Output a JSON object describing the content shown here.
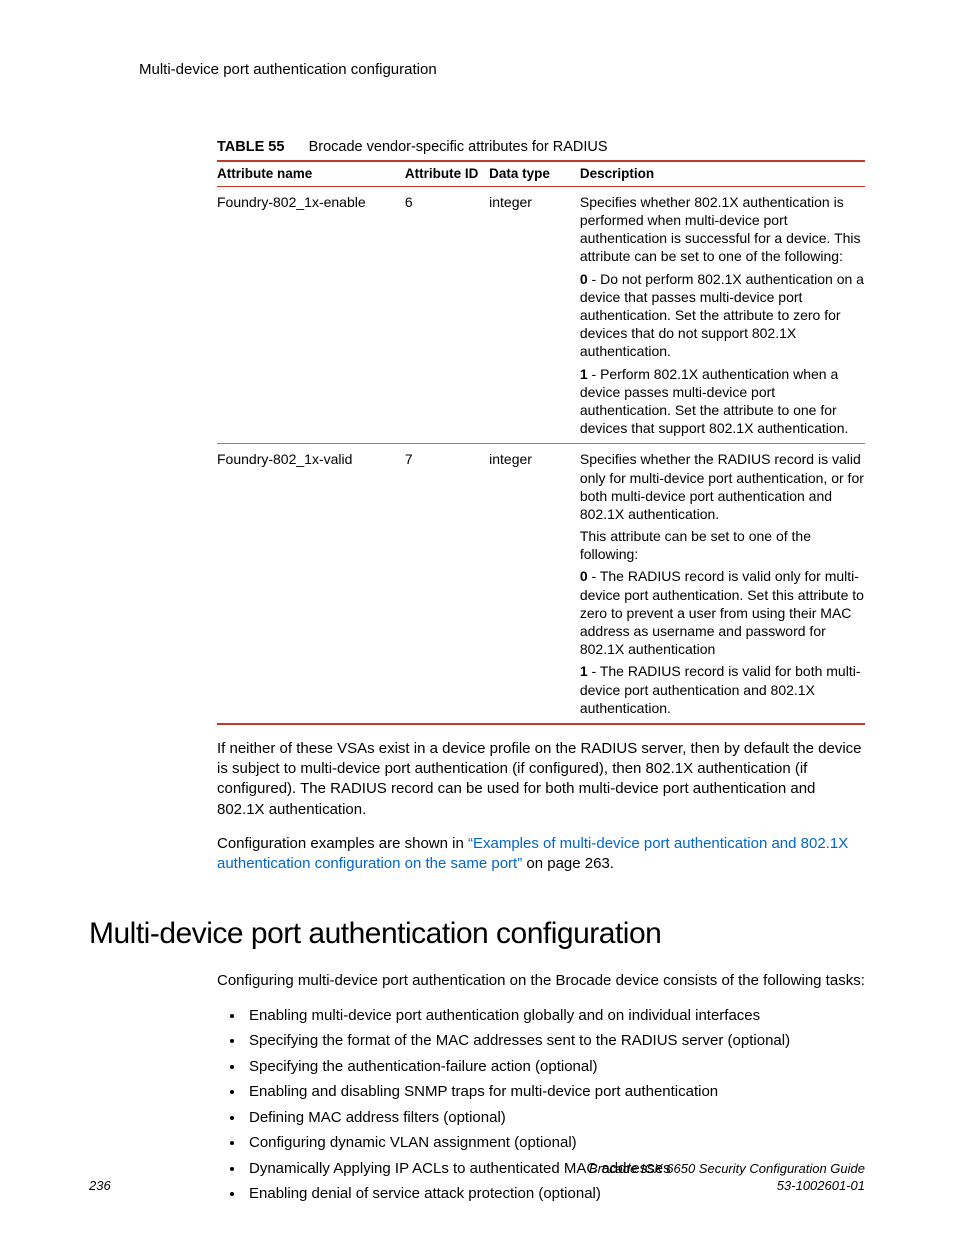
{
  "running_head": "Multi-device port authentication configuration",
  "table": {
    "label": "TABLE 55",
    "caption": "Brocade vendor-specific attributes for RADIUS",
    "headers": {
      "name": "Attribute name",
      "id": "Attribute ID",
      "type": "Data type",
      "desc": "Description"
    },
    "rows": [
      {
        "name": "Foundry-802_1x-enable",
        "id": "6",
        "type": "integer",
        "desc": {
          "intro": "Specifies whether 802.1X authentication is performed when multi-device port authentication is successful for a device. This attribute can be set to one of the following:",
          "opt0_lead": "0",
          "opt0_text": " - Do not perform 802.1X authentication on a device that passes multi-device port authentication. Set the attribute to zero for devices that do not support 802.1X authentication.",
          "opt1_lead": "1",
          "opt1_text": " - Perform 802.1X authentication when a device passes multi-device port authentication. Set the attribute to one for devices that support 802.1X authentication."
        }
      },
      {
        "name": "Foundry-802_1x-valid",
        "id": "7",
        "type": "integer",
        "desc": {
          "intro": "Specifies whether the RADIUS record is valid only for multi-device port authentication, or for both multi-device port authentication and 802.1X authentication.",
          "note": "This attribute can be set to one of the following:",
          "opt0_lead": "0",
          "opt0_text": " - The RADIUS record is valid only for multi-device port authentication. Set this attribute to zero to prevent a user from using their MAC address as username and password for 802.1X authentication",
          "opt1_lead": "1",
          "opt1_text": " - The RADIUS record is valid for both multi-device port authentication and 802.1X authentication."
        }
      }
    ]
  },
  "para1": "If neither of these VSAs exist in a device profile on the RADIUS server, then by default the device is subject to multi-device port authentication (if configured), then 802.1X authentication (if configured). The RADIUS record can be used for both multi-device port authentication and 802.1X authentication.",
  "para2_prefix": "Configuration examples are shown in ",
  "para2_link": "“Examples of multi-device port authentication and 802.1X authentication configuration on the same port”",
  "para2_suffix": " on page 263.",
  "section_heading": "Multi-device port authentication configuration",
  "section_intro": "Configuring multi-device port authentication on the Brocade device consists of the following tasks:",
  "tasks": [
    "Enabling multi-device port authentication globally and on individual interfaces",
    "Specifying the format of the MAC addresses sent to the RADIUS server (optional)",
    "Specifying the authentication-failure action (optional)",
    "Enabling and disabling SNMP traps for multi-device port authentication",
    "Defining MAC address filters (optional)",
    "Configuring dynamic VLAN assignment (optional)",
    "Dynamically Applying IP ACLs to authenticated MAC addresses",
    "Enabling denial of service attack protection (optional)"
  ],
  "footer": {
    "page": "236",
    "title": "Brocade ICX 6650 Security Configuration Guide",
    "docnum": "53-1002601-01"
  }
}
